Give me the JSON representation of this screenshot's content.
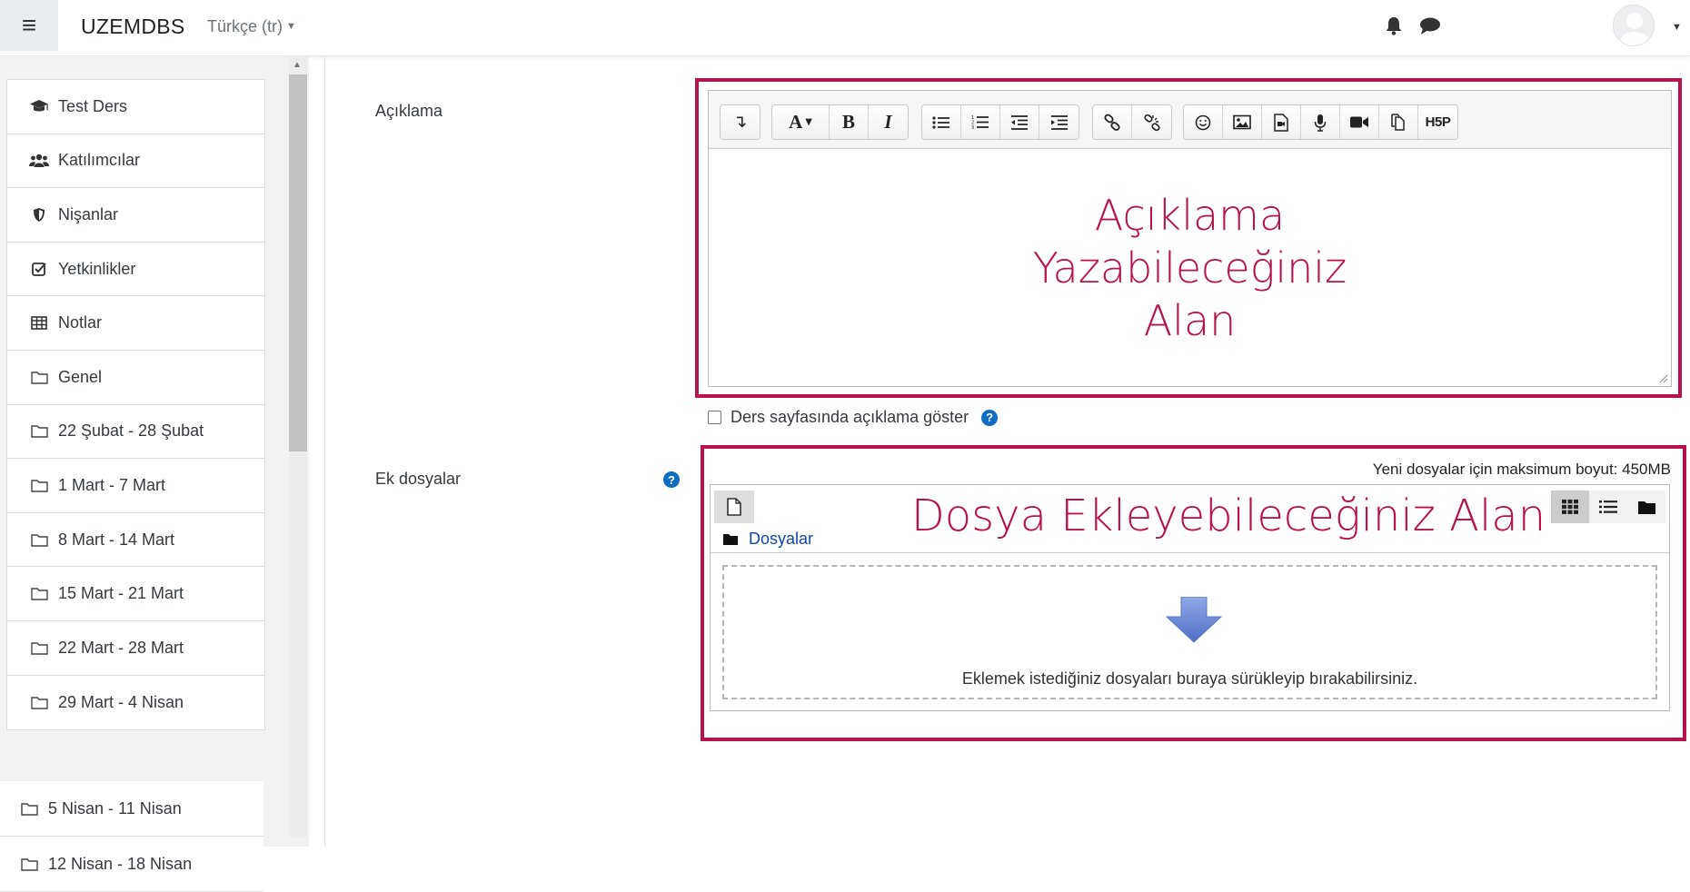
{
  "navbar": {
    "brand": "UZEMDBS",
    "language": "Türkçe (tr)",
    "menu_icon": "≡"
  },
  "sidebar": {
    "items": [
      {
        "label": "Test Ders",
        "icon": "graduation-cap-icon"
      },
      {
        "label": "Katılımcılar",
        "icon": "users-icon"
      },
      {
        "label": "Nişanlar",
        "icon": "shield-icon"
      },
      {
        "label": "Yetkinlikler",
        "icon": "check-square-icon"
      },
      {
        "label": "Notlar",
        "icon": "table-icon"
      },
      {
        "label": "Genel",
        "icon": "folder-icon"
      },
      {
        "label": "22 Şubat - 28 Şubat",
        "icon": "folder-icon"
      },
      {
        "label": "1 Mart - 7 Mart",
        "icon": "folder-icon"
      },
      {
        "label": "8 Mart - 14 Mart",
        "icon": "folder-icon"
      },
      {
        "label": "15 Mart - 21 Mart",
        "icon": "folder-icon"
      },
      {
        "label": "22 Mart - 28 Mart",
        "icon": "folder-icon"
      },
      {
        "label": "29 Mart - 4 Nisan",
        "icon": "folder-icon"
      }
    ],
    "items_extra": [
      {
        "label": "5 Nisan - 11 Nisan",
        "icon": "folder-icon"
      },
      {
        "label": "12 Nisan - 18 Nisan",
        "icon": "folder-icon"
      }
    ]
  },
  "form": {
    "description_label": "Açıklama",
    "description_overlay_line1": "Açıklama",
    "description_overlay_line2": "Yazabileceğiniz",
    "description_overlay_line3": "Alan",
    "show_description_label": "Ders sayfasında açıklama göster",
    "attachments_label": "Ek dosyalar",
    "max_size": "Yeni dosyalar için maksimum boyut: 450MB",
    "files_path": "Dosyalar",
    "files_overlay": "Dosya Ekleyebileceğiniz Alan",
    "drop_text": "Eklemek istediğiniz dosyaları buraya sürükleyip bırakabilirsiniz."
  },
  "toolbar": {
    "expand": "↴",
    "font": "A",
    "bold": "B",
    "italic": "I",
    "h5p": "H5P"
  },
  "colors": {
    "highlight": "#b8124e",
    "link": "#0f47ad",
    "help": "#0f6cbf"
  }
}
